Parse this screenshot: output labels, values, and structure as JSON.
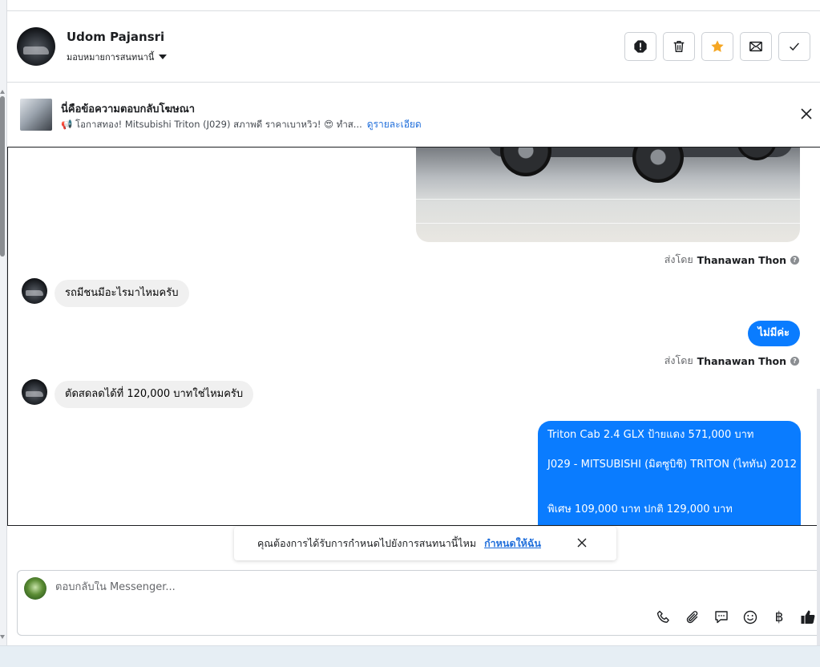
{
  "header": {
    "contact_name": "Udom Pajansri",
    "assign_label": "มอบหมายการสนทนานี้",
    "actions": [
      "report-icon",
      "trash-icon",
      "star-icon",
      "mail-icon",
      "check-icon"
    ],
    "star_color": "#f5a623"
  },
  "ad_banner": {
    "title": "นี่คือข้อความตอบกลับโฆษณา",
    "subtitle": "📢 โอกาสทอง! Mitsubishi Triton (J029) สภาพดี ราคาเบาหวิว! 😍 ทำส...",
    "details_link": "ดูรายละเอียด"
  },
  "messages": {
    "sent_by_label": "ส่งโดย",
    "agent_name": "Thanawan Thon",
    "incoming_1": "รถมีชนมีอะไรมาไหมครับ",
    "outgoing_1": "ไม่มีค่ะ",
    "incoming_2": "ตัดสดลดได้ที่ 120,000 บาทใช่ไหมครับ",
    "outgoing_long": {
      "line1": "Triton Cab 2.4 GLX ป้ายแดง 571,000 บาท",
      "line2": "J029 - MITSUBISHI (มิตซูบิชิ) TRITON (ไททัน) 2012",
      "line3": "พิเศษ 109,000 บาท ปกติ 129,000 บาท"
    }
  },
  "suggestion": {
    "text": "คุณต้องการได้รับการกำหนดไปยังการสนทนานี้ไหม",
    "link": "กำหนดให้ฉัน"
  },
  "composer": {
    "placeholder": "ตอบกลับใน Messenger...",
    "tools": [
      "phone-icon",
      "attachment-icon",
      "saved-replies-icon",
      "emoji-icon",
      "baht-icon",
      "thumbs-up-icon"
    ],
    "baht_symbol": "฿"
  },
  "colors": {
    "accent": "#0a7cff",
    "link": "#216fdb"
  }
}
